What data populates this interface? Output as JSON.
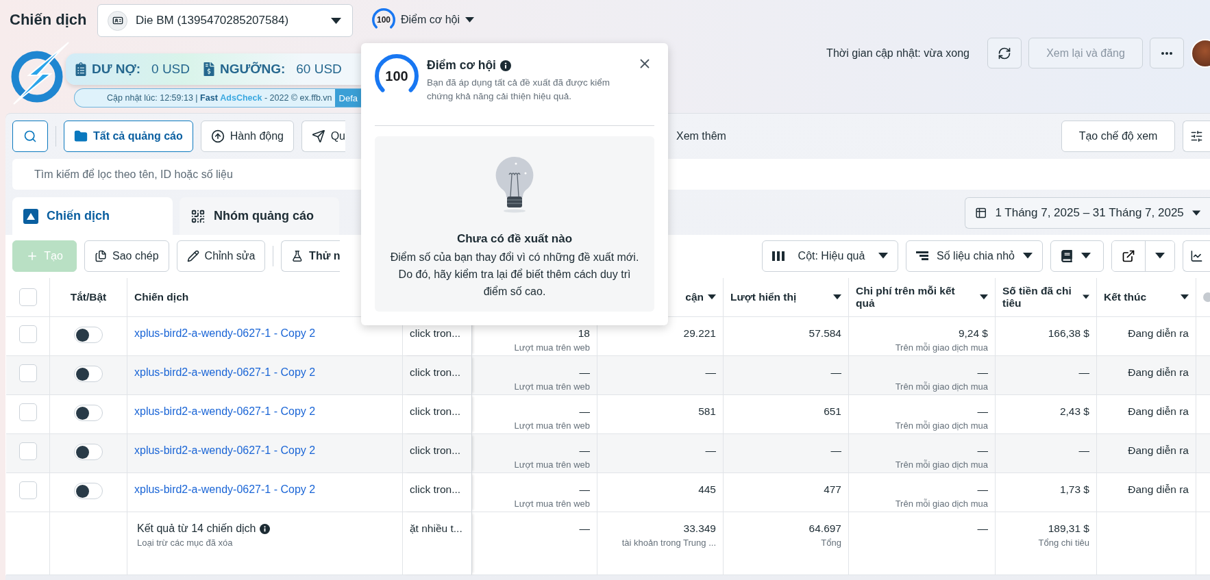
{
  "header": {
    "title": "Chiến dịch",
    "account": "Die BM (1395470285207584)",
    "score": {
      "value": "100",
      "level": 1,
      "label": "Điểm cơ hội"
    },
    "update_time": "Thời gian cập nhật: vừa xong",
    "review_button": {
      "label": "Xem lại và đăng",
      "disabled": true
    }
  },
  "extension": {
    "debt_label": "DƯ NỢ:",
    "debt_value": "0 USD",
    "threshold_label": "NGƯỠNG:",
    "threshold_value": "60 USD",
    "updated": "Cập nhật lúc: 12:59:13 |",
    "brand_a": "Fast",
    "brand_b": "AdsCheck",
    "copyright": "- 2022 © ex.ffb.vn",
    "button": "Defa"
  },
  "toolbar": {
    "buttons": [
      {
        "label": "Tất cả quảng cáo",
        "selected": true
      },
      {
        "label": "Hành động",
        "selected": false
      },
      {
        "label": "Qu",
        "selected": false
      }
    ],
    "more": "Xem thêm",
    "create_view": "Tạo chế độ xem"
  },
  "search": {
    "placeholder": "Tìm kiếm để lọc theo tên, ID hoặc số liệu"
  },
  "tabs": [
    {
      "label": "Chiến dịch",
      "selected": true
    },
    {
      "label": "Nhóm quảng cáo",
      "selected": false
    }
  ],
  "date_range": "1 Tháng 7, 2025 – 31 Tháng 7, 2025",
  "actions": [
    {
      "label": "Tạo",
      "disabled": true
    },
    {
      "label": "Sao chép",
      "disabled": false
    },
    {
      "label": "Chỉnh sửa",
      "disabled": false
    },
    {
      "label": "Thử n",
      "disabled": false
    }
  ],
  "view_controls": {
    "columns": "Cột: Hiệu quả",
    "breakdown": "Số liệu chia nhỏ"
  },
  "table": {
    "select_all_checked": false,
    "headers": {
      "toggle": "Tắt/Bật",
      "name": "Chiến dịch",
      "reach": "cận",
      "impressions": "Lượt hiển thị",
      "cost": "Chi phí trên mỗi kết quả",
      "spent": "Số tiền đã chi tiêu",
      "end": "Kết thúc"
    },
    "rows": [
      {
        "checked": false,
        "on": false,
        "name": "xplus-bird2-a-wendy-0627-1 - Copy 2",
        "column_3": "click tron...",
        "results": "18",
        "results_sub": "Lượt mua trên web",
        "reach": "29.221",
        "impressions": "57.584",
        "cost": "9,24 $",
        "cost_sub": "Trên mỗi giao dịch mua",
        "spent": "166,38 $",
        "end": "Đang diễn ra"
      },
      {
        "checked": false,
        "on": false,
        "name": "xplus-bird2-a-wendy-0627-1 - Copy 2",
        "column_3": "click tron...",
        "results": "—",
        "results_sub": "Lượt mua trên web",
        "reach": "—",
        "impressions": "—",
        "cost": "—",
        "cost_sub": "Trên mỗi giao dịch mua",
        "spent": "—",
        "end": "Đang diễn ra"
      },
      {
        "checked": false,
        "on": false,
        "name": "xplus-bird2-a-wendy-0627-1 - Copy 2",
        "column_3": "click tron...",
        "results": "—",
        "results_sub": "Lượt mua trên web",
        "reach": "581",
        "impressions": "651",
        "cost": "—",
        "cost_sub": "Trên mỗi giao dịch mua",
        "spent": "2,43 $",
        "end": "Đang diễn ra"
      },
      {
        "checked": false,
        "on": false,
        "name": "xplus-bird2-a-wendy-0627-1 - Copy 2",
        "column_3": "click tron...",
        "results": "—",
        "results_sub": "Lượt mua trên web",
        "reach": "—",
        "impressions": "—",
        "cost": "—",
        "cost_sub": "Trên mỗi giao dịch mua",
        "spent": "—",
        "end": "Đang diễn ra"
      },
      {
        "checked": false,
        "on": false,
        "name": "xplus-bird2-a-wendy-0627-1 - Copy 2",
        "column_3": "click tron...",
        "results": "—",
        "results_sub": "Lượt mua trên web",
        "reach": "445",
        "impressions": "477",
        "cost": "—",
        "cost_sub": "Trên mỗi giao dịch mua",
        "spent": "1,73 $",
        "end": "Đang diễn ra"
      }
    ],
    "total": {
      "label": "Kết quả từ 14 chiến dịch",
      "note": "Loại trừ các mục đã xóa",
      "column_3": "ặt nhiều t...",
      "results": "—",
      "reach": "33.349",
      "reach_sub": "tài khoản trong Trung ...",
      "impressions": "64.697",
      "impressions_sub": "Tổng",
      "cost": "—",
      "spent": "189,31 $",
      "spent_sub": "Tổng chi tiêu"
    }
  },
  "popup": {
    "score": "100",
    "level": 1,
    "title": "Điểm cơ hội",
    "description": "Bạn đã áp dụng tất cả đề xuất đã được kiểm chứng khả năng cải thiện hiệu quả.",
    "empty_title": "Chưa có đề xuất nào",
    "empty_text": "Điểm số của bạn thay đổi vì có những đề xuất mới. Do đó, hãy kiểm tra lại để biết thêm cách duy trì điểm số cao."
  }
}
